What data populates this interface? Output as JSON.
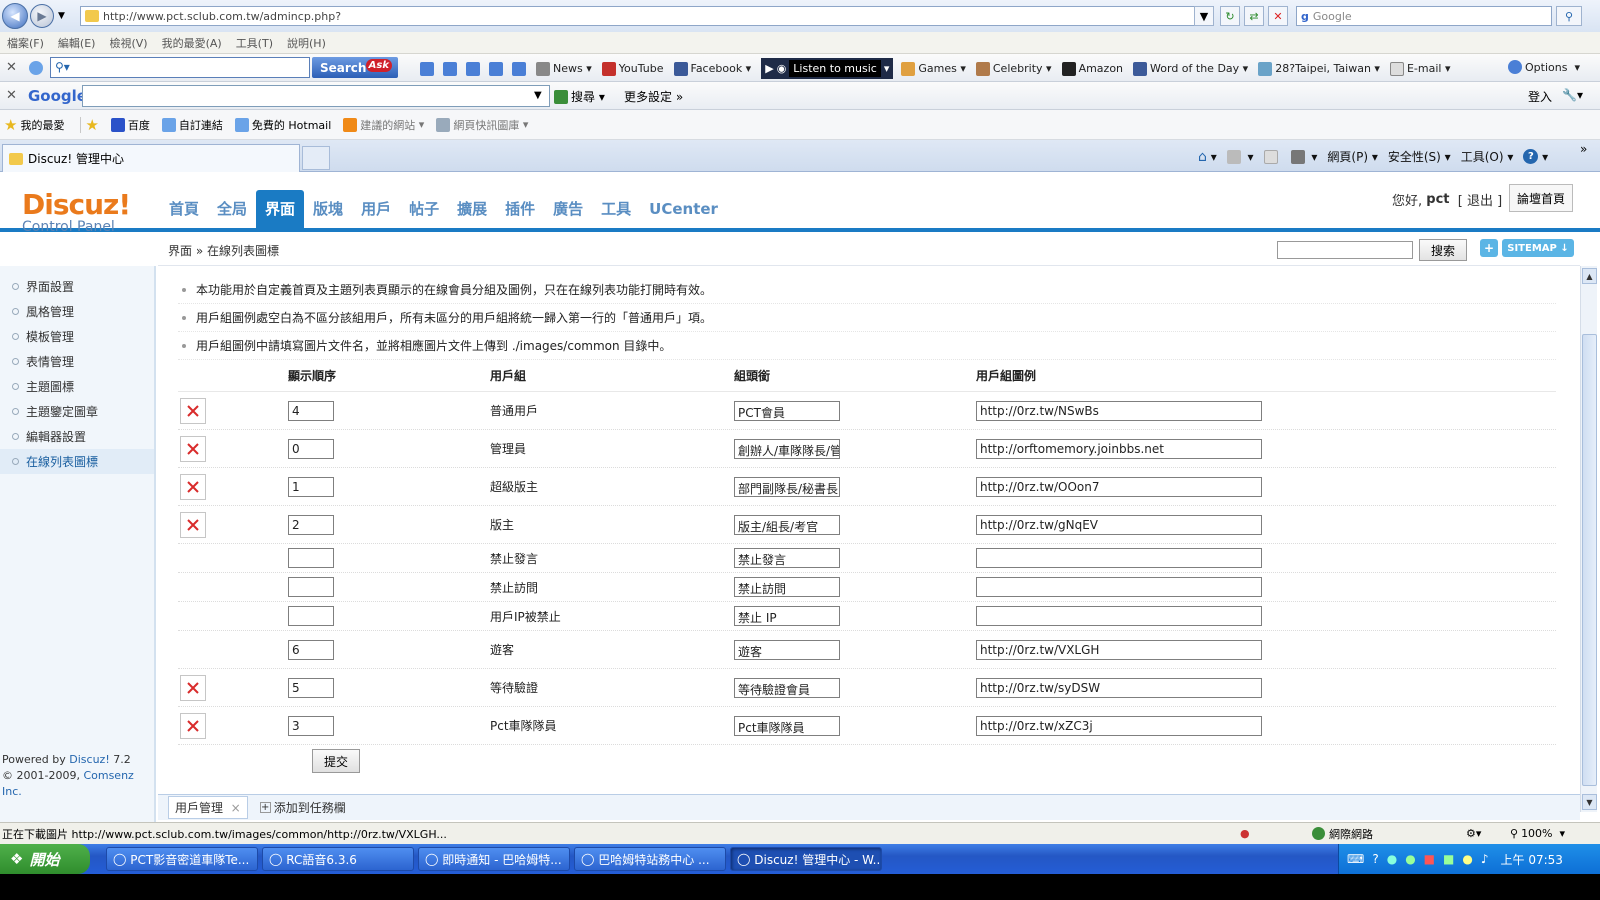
{
  "browser": {
    "address": "http://www.pct.sclub.com.tw/admincp.php?",
    "search_placeholder": "Google",
    "menu": [
      "檔案(F)",
      "編輯(E)",
      "檢視(V)",
      "我的最愛(A)",
      "工具(T)",
      "說明(H)"
    ],
    "ask_toolbar": {
      "search_label": "Search",
      "ask_logo": "Ask",
      "links": [
        "News",
        "YouTube",
        "Facebook",
        "Games",
        "Celebrity",
        "Amazon",
        "Word of the Day",
        "28?Taipei, Taiwan",
        "E-mail"
      ],
      "listen_label": "Listen to music",
      "options_label": "Options"
    },
    "google_toolbar": {
      "logo": "Google",
      "search_label": "搜尋",
      "more_label": "更多設定",
      "login_label": "登入"
    },
    "favorites": {
      "title": "我的最愛",
      "items": [
        "百度",
        "自訂連結",
        "免費的 Hotmail",
        "建議的網站",
        "網頁快訊圖庫"
      ]
    },
    "tab_title": "Discuz! 管理中心",
    "commands": [
      "網頁(P)",
      "安全性(S)",
      "工具(O)"
    ]
  },
  "app": {
    "logo_top": "Discuz!",
    "logo_sub": "Control Panel",
    "nav": [
      "首頁",
      "全局",
      "界面",
      "版塊",
      "用戶",
      "帖子",
      "擴展",
      "插件",
      "廣告",
      "工具",
      "UCenter"
    ],
    "active_nav": "界面",
    "greeting": "您好,",
    "username": "pct",
    "logout": "[ 退出 ]",
    "forum_home": "論壇首頁",
    "breadcrumb": "界面 » 在線列表圖標",
    "search_btn": "搜索",
    "sitemap": "SITEMAP",
    "sidebar": [
      "界面設置",
      "風格管理",
      "模板管理",
      "表情管理",
      "主題圖標",
      "主題鑒定圖章",
      "編輯器設置",
      "在線列表圖標"
    ],
    "sidebar_active": "在線列表圖標",
    "powered_prefix": "Powered by",
    "powered_product": "Discuz!",
    "powered_version": "7.2",
    "copyright_prefix": "© 2001-2009,",
    "copyright_company": "Comsenz Inc.",
    "tips": [
      "本功能用於自定義首頁及主題列表頁顯示的在線會員分組及圖例，只在在線列表功能打開時有效。",
      "用戶組圖例處空白為不區分該組用戶，所有未區分的用戶組將統一歸入第一行的「普通用戶」項。",
      "用戶組圖例中請填寫圖片文件名，並將相應圖片文件上傳到 ./images/common 目錄中。"
    ],
    "columns": [
      "顯示順序",
      "用戶組",
      "組頭銜",
      "用戶組圖例"
    ],
    "rows": [
      {
        "order": "4",
        "group": "普通用戶",
        "title": "PCT會員",
        "icon": "http://0rz.tw/NSwBs",
        "deletable": true
      },
      {
        "order": "0",
        "group": "管理員",
        "title": "創辦人/車隊隊長/管",
        "icon": "http://orftomemory.joinbbs.net",
        "deletable": true
      },
      {
        "order": "1",
        "group": "超級版主",
        "title": "部門副隊長/秘書長",
        "icon": "http://0rz.tw/OOon7",
        "deletable": true
      },
      {
        "order": "2",
        "group": "版主",
        "title": "版主/組長/考官",
        "icon": "http://0rz.tw/gNqEV",
        "deletable": true
      },
      {
        "order": "",
        "group": "禁止發言",
        "title": "禁止發言",
        "icon": "",
        "deletable": false
      },
      {
        "order": "",
        "group": "禁止訪問",
        "title": "禁止訪問",
        "icon": "",
        "deletable": false
      },
      {
        "order": "",
        "group": "用戶IP被禁止",
        "title": "禁止 IP",
        "icon": "",
        "deletable": false
      },
      {
        "order": "6",
        "group": "遊客",
        "title": "遊客",
        "icon": "http://0rz.tw/VXLGH",
        "deletable": false
      },
      {
        "order": "5",
        "group": "等待驗證",
        "title": "等待驗證會員",
        "icon": "http://0rz.tw/syDSW",
        "deletable": true
      },
      {
        "order": "3",
        "group": "Pct車隊隊員",
        "title": "Pct車隊隊員",
        "icon": "http://0rz.tw/xZC3j",
        "deletable": true
      }
    ],
    "submit": "提交",
    "bottom_tabs": [
      "用戶管理",
      "添加到任務欄"
    ]
  },
  "status": {
    "text": "正在下載圖片 http://www.pct.sclub.com.tw/images/common/http://0rz.tw/VXLGH...",
    "zone": "網際網路",
    "zoom": "100%"
  },
  "taskbar": {
    "start": "開始",
    "tasks": [
      "PCT影音密道車隊Te...",
      "RC語音6.3.6",
      "即時通知 - 巴哈姆特...",
      "巴哈姆特站務中心 ...",
      "Discuz! 管理中心 - W..."
    ],
    "clock": "上午 07:53"
  },
  "colors": {
    "accent": "#1a7bc4",
    "logo_orange": "#ea7a1c",
    "delete_red": "#d92b2b"
  }
}
